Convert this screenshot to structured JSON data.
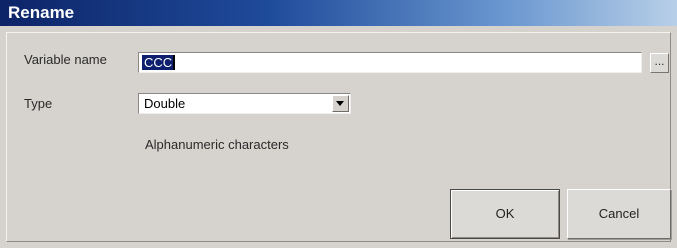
{
  "window": {
    "title": "Rename"
  },
  "form": {
    "variable_name_label": "Variable name",
    "variable_name_value": "CCC",
    "browse_label": "...",
    "type_label": "Type",
    "type_selected": "Double",
    "hint_text": "Alphanumeric characters"
  },
  "buttons": {
    "ok_label": "OK",
    "cancel_label": "Cancel"
  },
  "colors": {
    "title_bar_start": "#0d2467",
    "title_bar_end": "#b8cfe8",
    "dialog_bg": "#d6d3ce",
    "selection_bg": "#0d1f6e"
  }
}
